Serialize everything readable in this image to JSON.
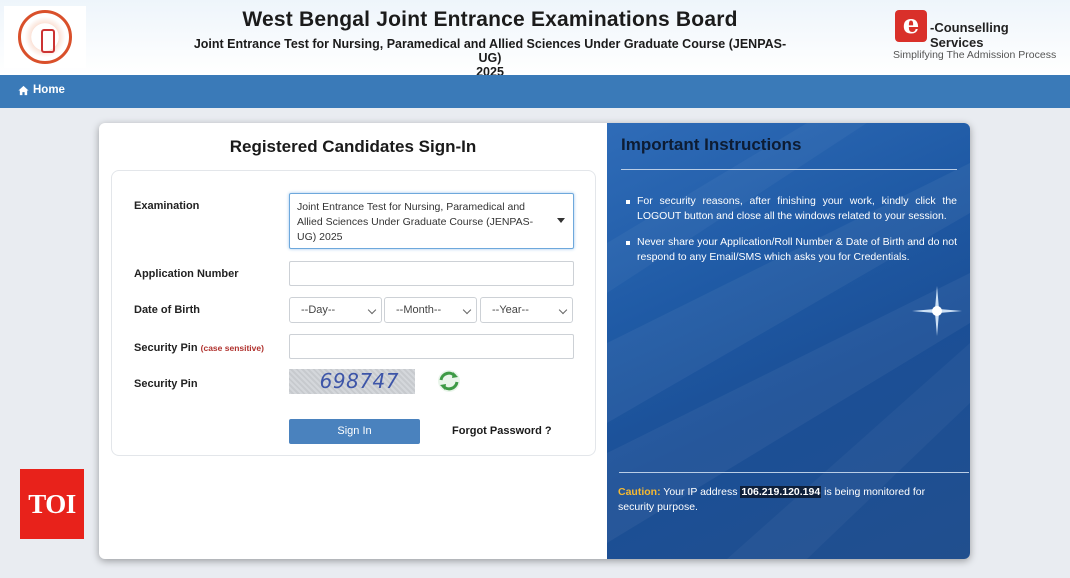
{
  "header": {
    "title": "West Bengal Joint Entrance Examinations Board",
    "subtitle_line1": "Joint Entrance Test for Nursing, Paramedical and Allied Sciences Under Graduate Course (JENPAS-UG)",
    "subtitle_line2": "2025",
    "brand_mark": "e",
    "brand_name": "-Counselling Services",
    "brand_tagline": "Simplifying The Admission Process"
  },
  "nav": {
    "home_label": "Home",
    "home_icon": "home-icon"
  },
  "signin": {
    "title": "Registered Candidates Sign-In",
    "examination_label": "Examination",
    "examination_value": "Joint Entrance Test for Nursing, Paramedical and Allied Sciences Under Graduate Course (JENPAS-UG) 2025",
    "application_number_label": "Application Number",
    "application_number_value": "",
    "dob_label": "Date of Birth",
    "dob_day": "--Day--",
    "dob_month": "--Month--",
    "dob_year": "--Year--",
    "security_pin_label": "Security Pin",
    "security_pin_note": "(case sensitive)",
    "security_pin_value": "",
    "captcha_label": "Security Pin",
    "captcha_text": "698747",
    "refresh_icon": "refresh-icon",
    "signin_button": "Sign In",
    "forgot_password": "Forgot Password ?"
  },
  "instructions": {
    "title": "Important Instructions",
    "items": [
      "For security reasons, after finishing your work, kindly click the LOGOUT button and close all the windows related to your session.",
      "Never share your Application/Roll Number & Date of Birth and do not respond to any Email/SMS which asks you for Credentials."
    ],
    "caution_label": "Caution:",
    "caution_text_before": " Your IP address ",
    "ip_address": "106.219.120.194",
    "caution_text_after": " is being monitored for security purpose."
  },
  "watermark": {
    "text": "TOI"
  },
  "colors": {
    "navbar": "#3a7ab8",
    "button": "#4a82be",
    "instructions_bg": "#1f5aa5",
    "caution": "#f5b932",
    "toi_red": "#e8221b"
  }
}
